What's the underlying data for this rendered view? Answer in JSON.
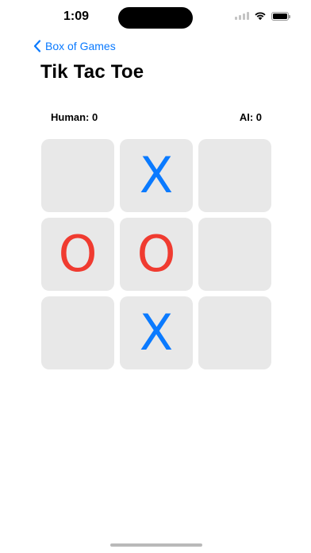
{
  "status_bar": {
    "time": "1:09"
  },
  "nav": {
    "back_label": "Box of Games"
  },
  "page": {
    "title": "Tik Tac Toe"
  },
  "score": {
    "human": "Human: 0",
    "ai": "AI: 0"
  },
  "board": {
    "cells": [
      "",
      "X",
      "",
      "O",
      "O",
      "",
      "",
      "X",
      ""
    ]
  },
  "colors": {
    "accent": "#0a7aff",
    "x_mark": "#0a7aff",
    "o_mark": "#f03b30",
    "cell_bg": "#e8e8e8"
  },
  "icons": [
    "chevron-left-icon",
    "wifi-icon",
    "battery-icon",
    "cellular-icon"
  ]
}
